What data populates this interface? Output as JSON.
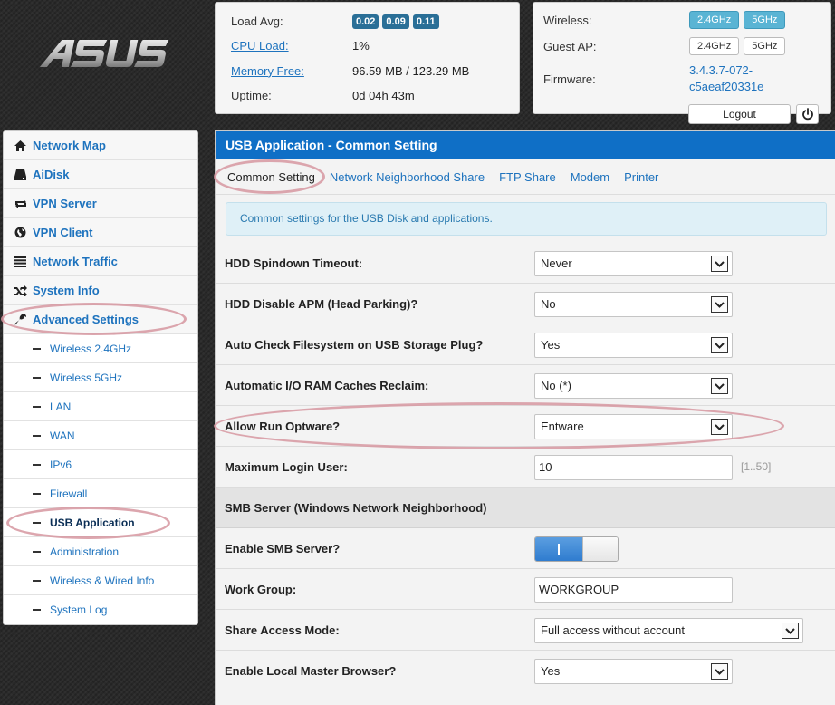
{
  "logo": {
    "text": "ASUS"
  },
  "status": {
    "load_avg_label": "Load Avg:",
    "load_avg": [
      "0.02",
      "0.09",
      "0.11"
    ],
    "cpu_label": "CPU Load:",
    "cpu_value": "1%",
    "mem_label": "Memory Free:",
    "mem_value": "96.59 MB / 123.29 MB",
    "uptime_label": "Uptime:",
    "uptime_value": "0d 04h 43m"
  },
  "wifi": {
    "wireless_label": "Wireless:",
    "guest_label": "Guest AP:",
    "band_24": "2.4GHz",
    "band_5": "5GHz",
    "firmware_label": "Firmware:",
    "firmware_value": "3.4.3.7-072-c5aeaf20331e",
    "logout": "Logout"
  },
  "sidebar": {
    "items": [
      {
        "label": "Network Map",
        "icon": "home-icon"
      },
      {
        "label": "AiDisk",
        "icon": "disk-icon"
      },
      {
        "label": "VPN Server",
        "icon": "retweet-icon"
      },
      {
        "label": "VPN Client",
        "icon": "globe-icon"
      },
      {
        "label": "Network Traffic",
        "icon": "list-icon"
      },
      {
        "label": "System Info",
        "icon": "shuffle-icon"
      },
      {
        "label": "Advanced Settings",
        "icon": "wrench-icon"
      }
    ],
    "sub_items": [
      "Wireless 2.4GHz",
      "Wireless 5GHz",
      "LAN",
      "WAN",
      "IPv6",
      "Firewall",
      "USB Application",
      "Administration",
      "Wireless & Wired Info",
      "System Log"
    ]
  },
  "main": {
    "title": "USB Application - Common Setting",
    "tabs": [
      "Common Setting",
      "Network Neighborhood Share",
      "FTP Share",
      "Modem",
      "Printer"
    ],
    "info": "Common settings for the USB Disk and applications.",
    "fields": {
      "hdd_spindown": {
        "label": "HDD Spindown Timeout:",
        "value": "Never"
      },
      "hdd_apm": {
        "label": "HDD Disable APM (Head Parking)?",
        "value": "No"
      },
      "auto_check": {
        "label": "Auto Check Filesystem on USB Storage Plug?",
        "value": "Yes"
      },
      "ram_reclaim": {
        "label": "Automatic I/O RAM Caches Reclaim:",
        "value": "No (*)"
      },
      "optware": {
        "label": "Allow Run Optware?",
        "value": "Entware"
      },
      "max_login": {
        "label": "Maximum Login User:",
        "value": "10",
        "hint": "[1..50]"
      },
      "smb_section": "SMB Server (Windows Network Neighborhood)",
      "smb_enable": {
        "label": "Enable SMB Server?",
        "state": "on"
      },
      "workgroup": {
        "label": "Work Group:",
        "value": "WORKGROUP"
      },
      "share_mode": {
        "label": "Share Access Mode:",
        "value": "Full access without account"
      },
      "master_browser": {
        "label": "Enable Local Master Browser?",
        "value": "Yes"
      }
    }
  },
  "colors": {
    "header_blue": "#0f6fc6",
    "link_blue": "#1e73be",
    "badge_blue": "#2a6f97",
    "band_active": "#5ab4d4",
    "highlight": "#d696a0"
  }
}
